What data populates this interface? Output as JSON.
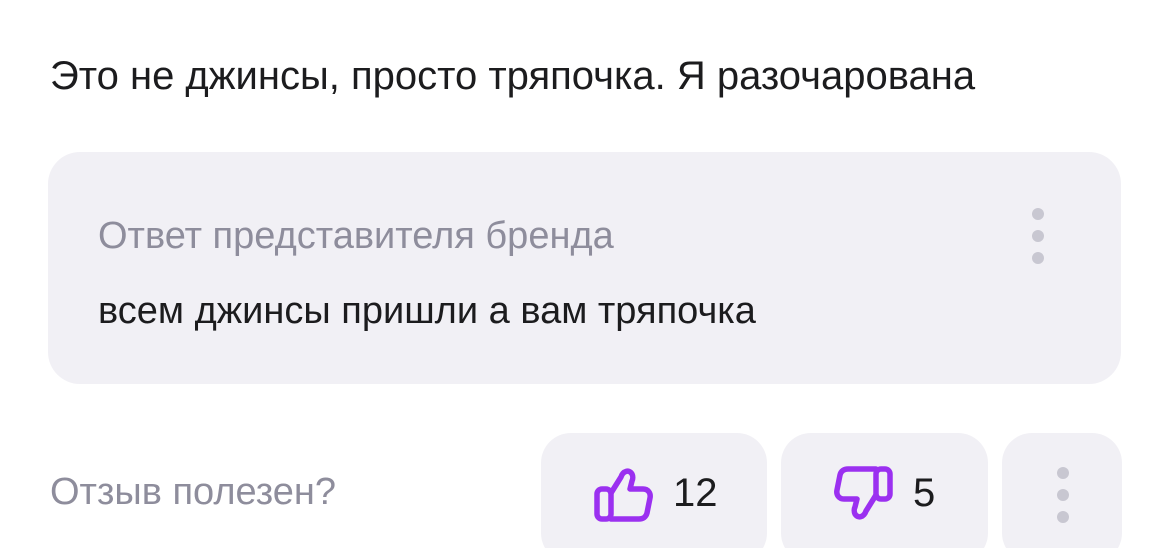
{
  "review": {
    "text": "Это не джинсы, просто тряпочка. Я разочарована"
  },
  "brand_reply": {
    "title": "Ответ представителя бренда",
    "text": "всем джинсы пришли а вам тряпочка",
    "menu_icon": "more-vertical-icon"
  },
  "feedback": {
    "question": "Отзыв полезен?",
    "likes": "12",
    "dislikes": "5",
    "like_icon": "thumbs-up-icon",
    "dislike_icon": "thumbs-down-icon",
    "more_icon": "more-vertical-icon"
  },
  "colors": {
    "accent": "#9b30f0",
    "panel": "#f1f0f5",
    "muted_text": "#8e8d9c",
    "text": "#1c1c1e"
  }
}
